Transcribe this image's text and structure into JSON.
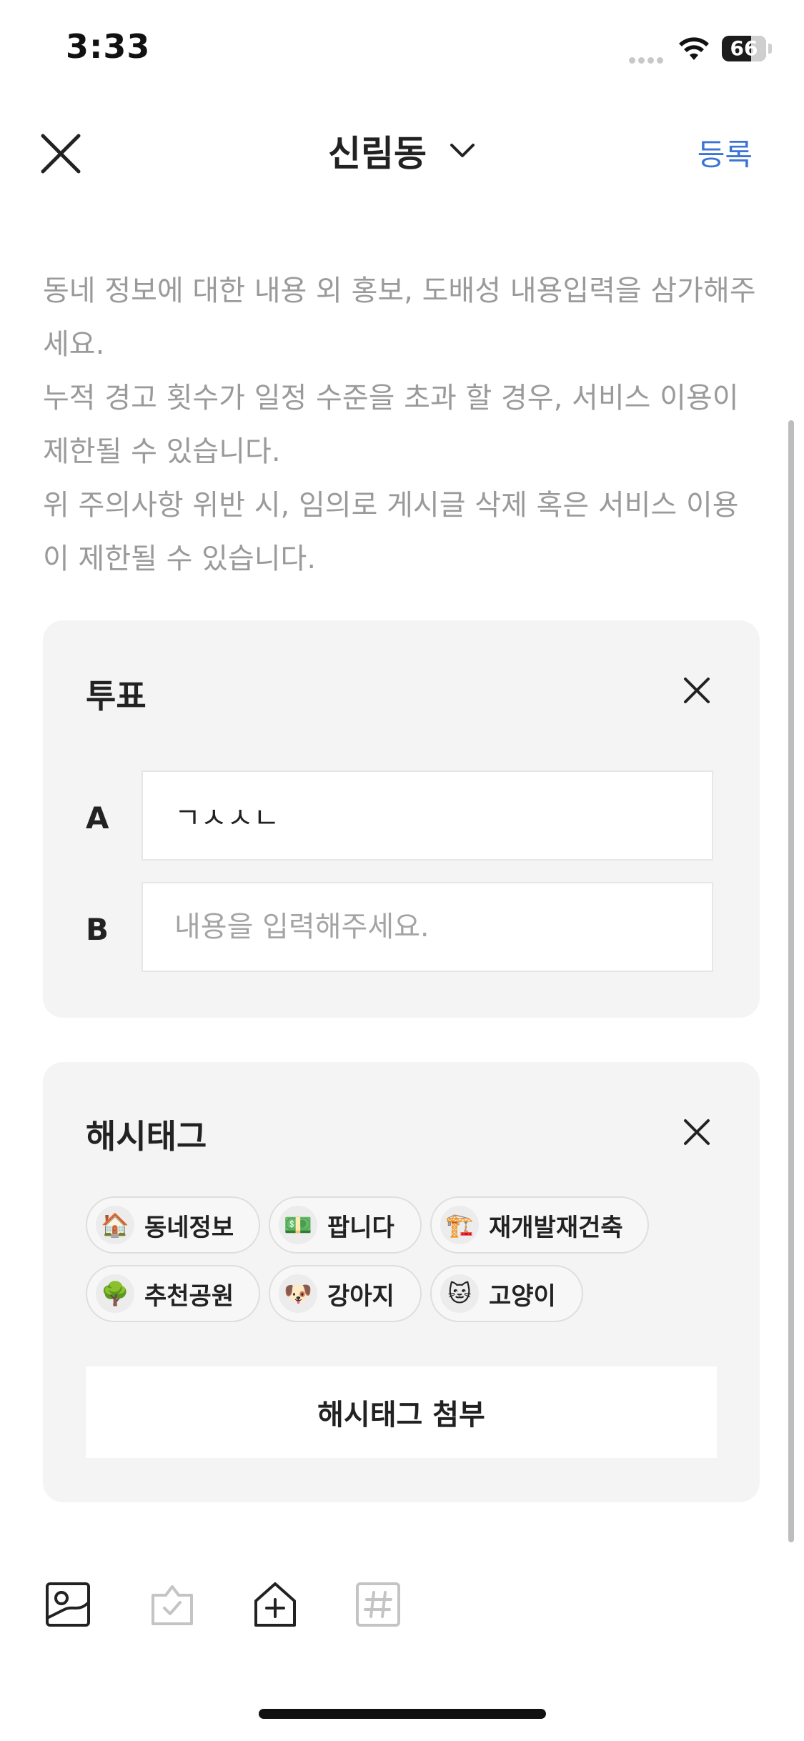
{
  "status_bar": {
    "time": "3:33",
    "battery": "66"
  },
  "header": {
    "title": "신림동",
    "submit_label": "등록"
  },
  "notice": {
    "lines": [
      "동네 정보에 대한 내용 외 홍보, 도배성 내용입력을 삼가해주세요.",
      "누적 경고 횟수가 일정 수준을 초과 할 경우, 서비스 이용이 제한될 수 있습니다.",
      "위 주의사항 위반 시, 임의로 게시글 삭제 혹은 서비스 이용이 제한될 수 있습니다."
    ]
  },
  "vote": {
    "title": "투표",
    "options": [
      {
        "label": "A",
        "value": "ㄱㅅㅅㄴ",
        "placeholder": "내용을 입력해주세요."
      },
      {
        "label": "B",
        "value": "",
        "placeholder": "내용을 입력해주세요."
      }
    ]
  },
  "hashtags": {
    "title": "해시태그",
    "chips": [
      {
        "emoji": "🏠",
        "label": "동네정보"
      },
      {
        "emoji": "💵",
        "label": "팝니다"
      },
      {
        "emoji": "🏗️",
        "label": "재개발재건축"
      },
      {
        "emoji": "🌳",
        "label": "추천공원"
      },
      {
        "emoji": "🐶",
        "label": "강아지"
      },
      {
        "emoji": "🐱",
        "label": "고양이"
      }
    ],
    "attach_label": "해시태그 첨부"
  },
  "toolbar": {
    "items": [
      "photo-icon",
      "vote-icon",
      "neighborhood-add-icon",
      "hashtag-icon"
    ]
  },
  "colors": {
    "accent": "#3b73d6",
    "card_bg": "#f4f4f4",
    "muted_text": "#9a9a9a"
  }
}
